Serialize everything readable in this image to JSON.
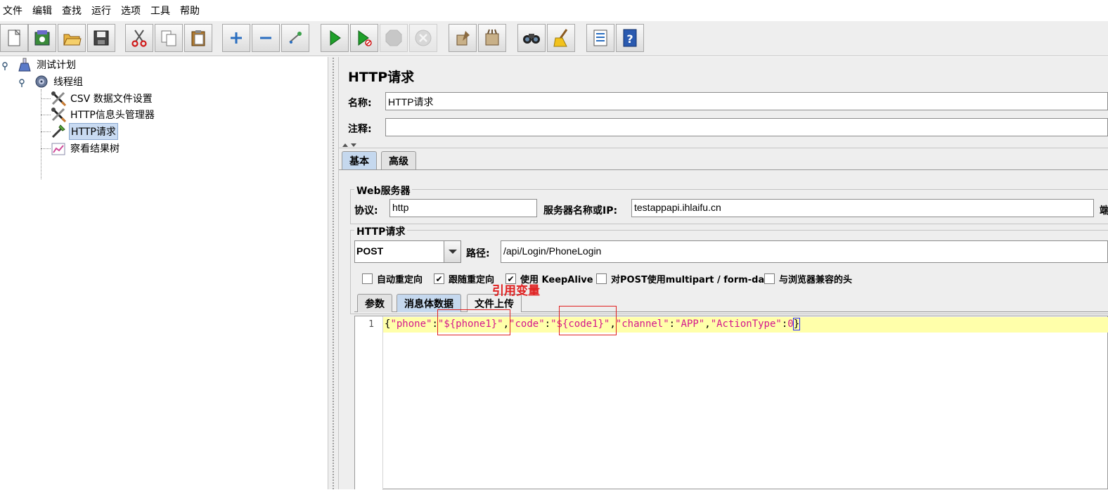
{
  "menu": [
    "文件",
    "编辑",
    "查找",
    "运行",
    "选项",
    "工具",
    "帮助"
  ],
  "toolbar": {
    "buttons": [
      {
        "name": "new-icon"
      },
      {
        "name": "templates-icon"
      },
      {
        "name": "open-icon"
      },
      {
        "name": "save-icon"
      },
      {
        "name": "cut-icon"
      },
      {
        "name": "copy-icon"
      },
      {
        "name": "paste-icon"
      },
      {
        "name": "expand-icon"
      },
      {
        "name": "collapse-icon"
      },
      {
        "name": "toggle-icon"
      },
      {
        "name": "start-icon"
      },
      {
        "name": "start-no-pause-icon"
      },
      {
        "name": "stop-icon"
      },
      {
        "name": "shutdown-icon"
      },
      {
        "name": "clear-icon"
      },
      {
        "name": "clear-all-icon"
      },
      {
        "name": "search-icon"
      },
      {
        "name": "reset-search-icon"
      },
      {
        "name": "function-helper-icon"
      },
      {
        "name": "help-icon"
      }
    ]
  },
  "tree": {
    "nodes": [
      {
        "label": "测试计划",
        "icon": "test-plan-icon"
      },
      {
        "label": "线程组",
        "icon": "thread-group-icon"
      },
      {
        "label": "CSV 数据文件设置",
        "icon": "config-element-icon"
      },
      {
        "label": "HTTP信息头管理器",
        "icon": "config-element-icon"
      },
      {
        "label": "HTTP请求",
        "icon": "sampler-icon",
        "selected": true
      },
      {
        "label": "察看结果树",
        "icon": "listener-icon"
      }
    ]
  },
  "panel": {
    "title": "HTTP请求",
    "name_label": "名称:",
    "name_value": "HTTP请求",
    "comment_label": "注释:",
    "comment_value": "",
    "tabs": [
      "基本",
      "高级"
    ],
    "web_server": {
      "title": "Web服务器",
      "protocol_label": "协议:",
      "protocol_value": "http",
      "server_label": "服务器名称或IP:",
      "server_value": "testappapi.ihlaifu.cn",
      "port_label_fragment": "端"
    },
    "http_request": {
      "title": "HTTP请求",
      "method": "POST",
      "path_label": "路径:",
      "path_value": "/api/Login/PhoneLogin"
    },
    "checkboxes": [
      {
        "label": "自动重定向",
        "checked": false
      },
      {
        "label": "跟随重定向",
        "checked": true
      },
      {
        "label": "使用 KeepAlive",
        "checked": true
      },
      {
        "label": "对POST使用multipart / form-data",
        "checked": false
      },
      {
        "label": "与浏览器兼容的头",
        "checked": false
      }
    ],
    "body_tabs": [
      "参数",
      "消息体数据",
      "文件上传"
    ],
    "editor": {
      "line_number": "1",
      "tokens": [
        {
          "t": "{",
          "c": "punc"
        },
        {
          "t": "\"phone\"",
          "c": "str"
        },
        {
          "t": ":",
          "c": "punc"
        },
        {
          "t": "\"${phone1}\"",
          "c": "str"
        },
        {
          "t": ",",
          "c": "punc"
        },
        {
          "t": "\"code\"",
          "c": "str"
        },
        {
          "t": ":",
          "c": "punc"
        },
        {
          "t": "\"${code1}\"",
          "c": "str"
        },
        {
          "t": ",",
          "c": "punc"
        },
        {
          "t": "\"channel\"",
          "c": "str"
        },
        {
          "t": ":",
          "c": "punc"
        },
        {
          "t": "\"APP\"",
          "c": "str"
        },
        {
          "t": ",",
          "c": "punc"
        },
        {
          "t": "\"ActionType\"",
          "c": "str"
        },
        {
          "t": ":",
          "c": "punc"
        },
        {
          "t": "0",
          "c": "num"
        },
        {
          "t": "}",
          "c": "punc"
        }
      ]
    }
  },
  "annotation": {
    "label": "引用变量",
    "color": "#e02020"
  }
}
